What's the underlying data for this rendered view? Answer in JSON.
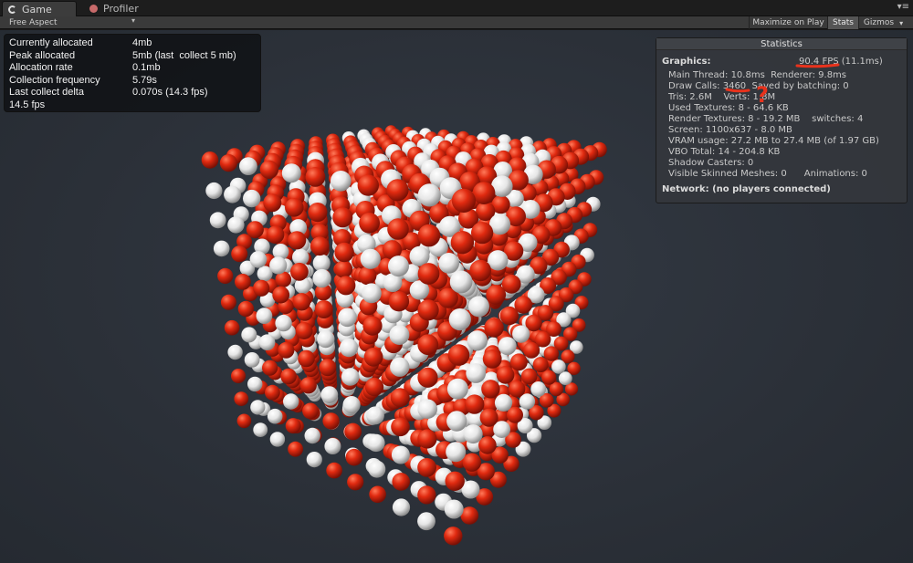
{
  "tabs": [
    {
      "label": "Game",
      "icon": "game-controller-icon"
    },
    {
      "label": "Profiler",
      "icon": "profiler-icon"
    }
  ],
  "window_menu_glyph": "▾≡",
  "toolbar": {
    "aspect_label": "Free Aspect",
    "aspect_arrow": "▾",
    "maximize_label": "Maximize on Play",
    "stats_label": "Stats",
    "gizmos_label": "Gizmos",
    "gizmos_arrow": "▾"
  },
  "memory_stats": {
    "rows": [
      {
        "label": "Currently allocated",
        "value": "4mb"
      },
      {
        "label": "Peak allocated",
        "value": "5mb (last  collect 5 mb)"
      },
      {
        "label": "Allocation rate",
        "value": "0.1mb"
      },
      {
        "label": "Collection frequency",
        "value": "5.79s"
      },
      {
        "label": "Last collect delta",
        "value": "0.070s (14.3 fps)"
      }
    ],
    "fps": "14.5 fps"
  },
  "statistics": {
    "title": "Statistics",
    "graphics_label": "Graphics:",
    "fps": "90.4 FPS (11.1ms)",
    "main_thread": "Main Thread: 10.8ms  Renderer: 9.8ms",
    "draw_calls": "Draw Calls: 3460  Saved by batching: 0",
    "tris": "Tris: 2.6M    Verts: 1.8M",
    "used_textures": "Used Textures: 8 - 64.6 KB",
    "render_textures": "Render Textures: 8 - 19.2 MB    switches: 4",
    "screen": "Screen: 1100x637 - 8.0 MB",
    "vram": "VRAM usage: 27.2 MB to 27.4 MB (of 1.97 GB)",
    "vbo": "VBO Total: 14 - 204.8 KB",
    "shadow": "Shadow Casters: 0",
    "skinned": "Visible Skinned Meshes: 0      Animations: 0",
    "network": "Network: (no players connected)"
  },
  "annotation": {
    "color": "#e8321c",
    "question_mark": "?"
  },
  "scene": {
    "sphere_colors": [
      "#e02a10",
      "#f2f2f2"
    ]
  }
}
